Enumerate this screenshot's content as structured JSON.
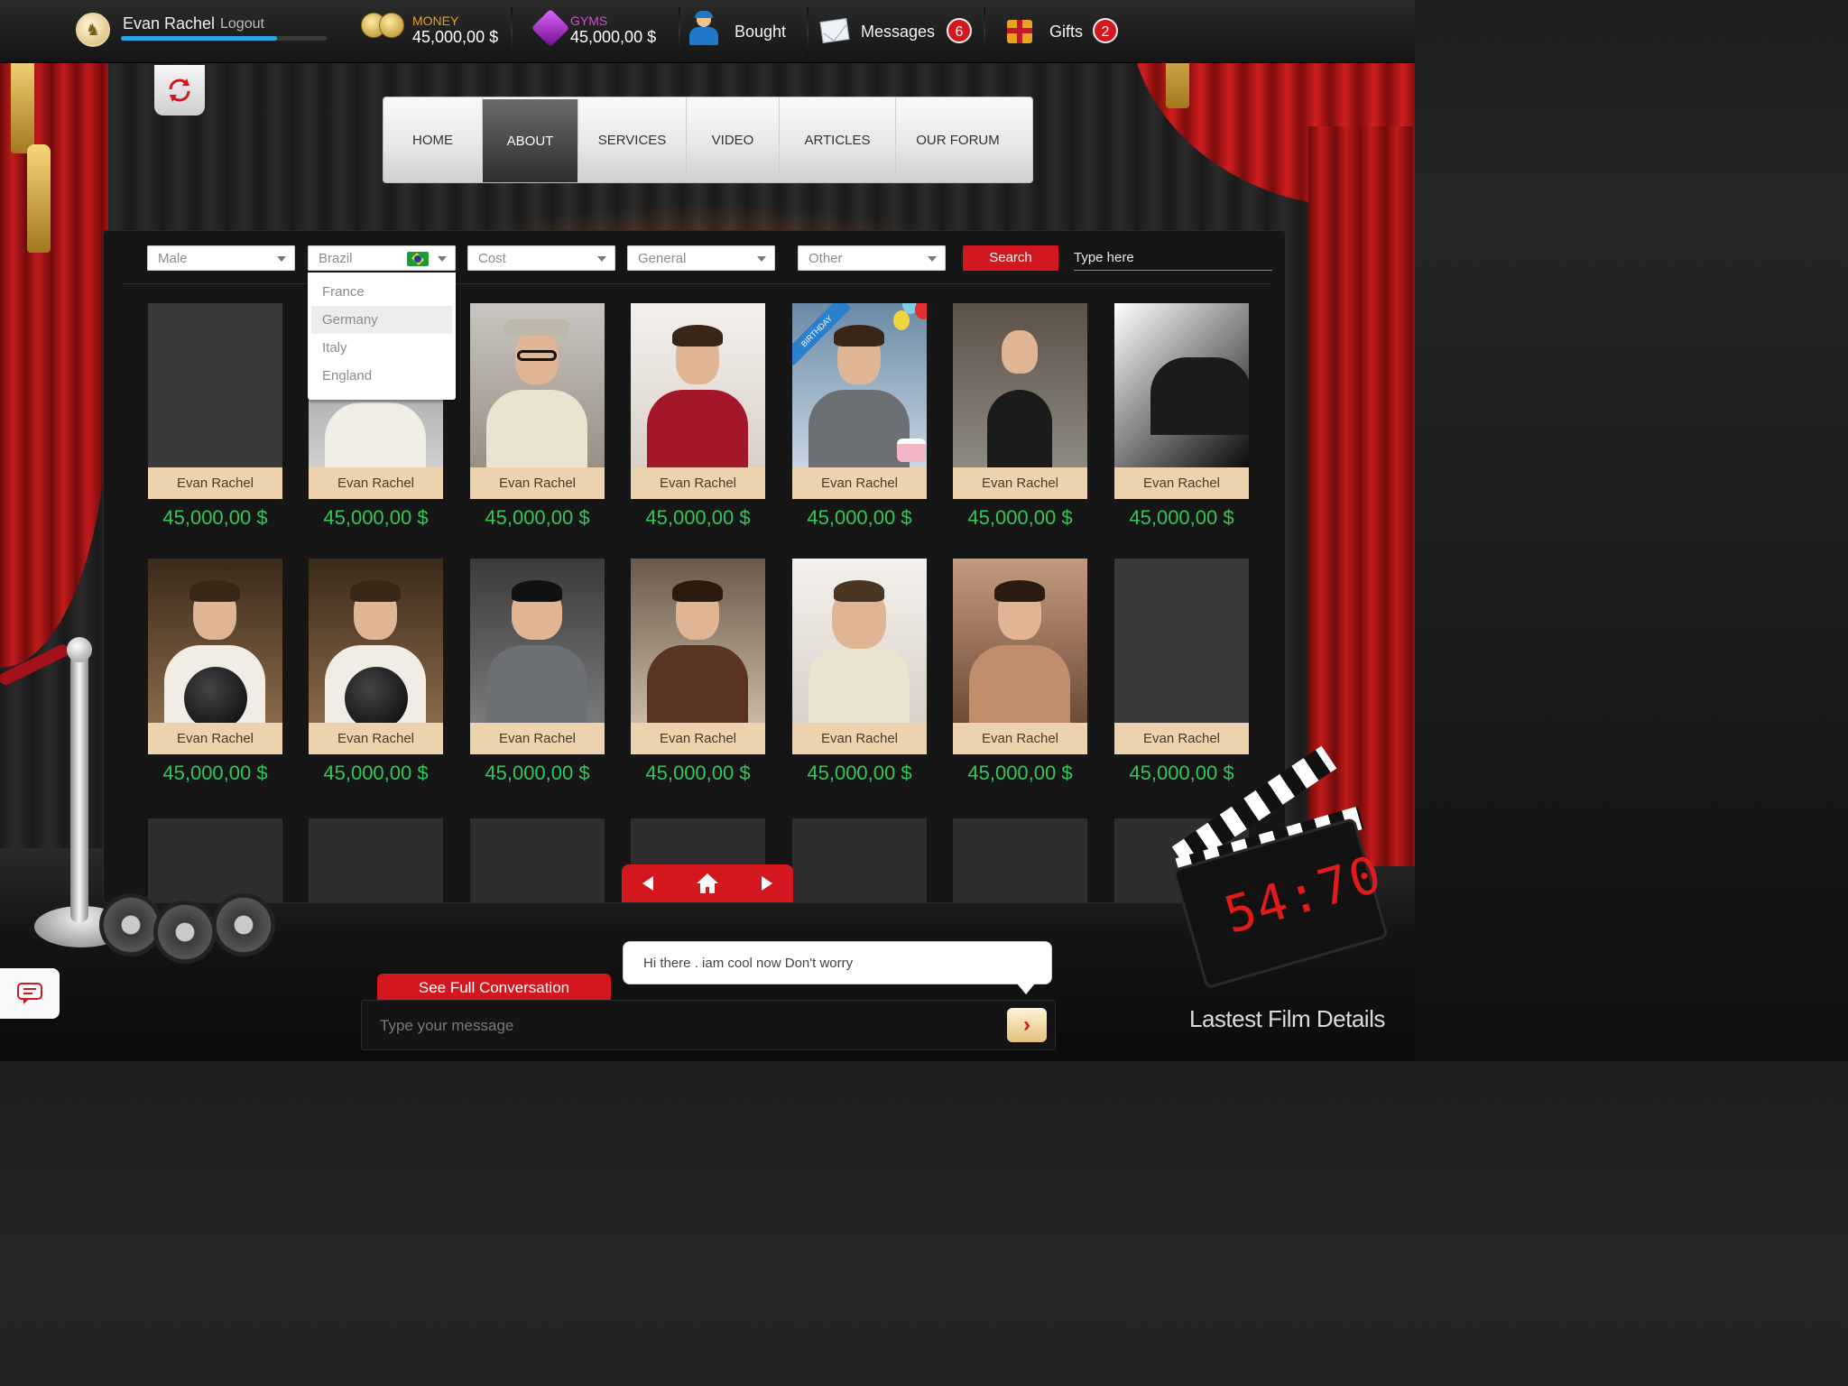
{
  "user": {
    "name": "Evan Rachel",
    "logout_label": "Logout",
    "xp_progress": 0.76
  },
  "stats": [
    {
      "label": "MONEY",
      "value": "45,000,00 $",
      "label_color": "#e8a321"
    },
    {
      "label": "GYMS",
      "value": "45,000,00 $",
      "label_color": "#d84bd8"
    }
  ],
  "topbar": {
    "bought_label": "Bought",
    "messages_label": "Messages",
    "messages_count": "6",
    "gifts_label": "Gifts",
    "gifts_count": "2"
  },
  "nav": {
    "items": [
      "HOME",
      "ABOUT",
      "SERVICES",
      "VIDEO",
      "ARTICLES",
      "OUR FORUM"
    ],
    "active": "ABOUT"
  },
  "filters": {
    "gender": "Male",
    "country": "Brazil",
    "cost": "Cost",
    "category": "General",
    "other": "Other",
    "search_label": "Search",
    "search_placeholder": "Type here",
    "country_options": [
      "France",
      "Germany",
      "Italy",
      "England"
    ],
    "country_hover": "Germany"
  },
  "cards_row1": [
    {
      "name": "Evan Rachel",
      "price": "45,000,00 $"
    },
    {
      "name": "Evan Rachel",
      "price": "45,000,00 $"
    },
    {
      "name": "Evan Rachel",
      "price": "45,000,00 $"
    },
    {
      "name": "Evan Rachel",
      "price": "45,000,00 $"
    },
    {
      "name": "Evan Rachel",
      "price": "45,000,00 $",
      "ribbon": "BIRTHDAY"
    },
    {
      "name": "Evan Rachel",
      "price": "45,000,00 $"
    },
    {
      "name": "Evan Rachel",
      "price": "45,000,00 $"
    }
  ],
  "cards_row2": [
    {
      "name": "Evan Rachel",
      "price": "45,000,00 $"
    },
    {
      "name": "Evan Rachel",
      "price": "45,000,00 $"
    },
    {
      "name": "Evan Rachel",
      "price": "45,000,00 $"
    },
    {
      "name": "Evan Rachel",
      "price": "45,000,00 $"
    },
    {
      "name": "Evan Rachel",
      "price": "45,000,00 $"
    },
    {
      "name": "Evan Rachel",
      "price": "45,000,00 $"
    },
    {
      "name": "Evan Rachel",
      "price": "45,000,00 $"
    }
  ],
  "chat": {
    "latest_message": "Hi there . iam cool now Don't worry",
    "see_full_label": "See Full Conversation",
    "input_placeholder": "Type your message"
  },
  "film": {
    "timer": "54:70",
    "details_label": "Lastest Film Details"
  },
  "colors": {
    "accent": "#d3171e",
    "price": "#34c758",
    "name_plate": "#ecd3ad"
  }
}
